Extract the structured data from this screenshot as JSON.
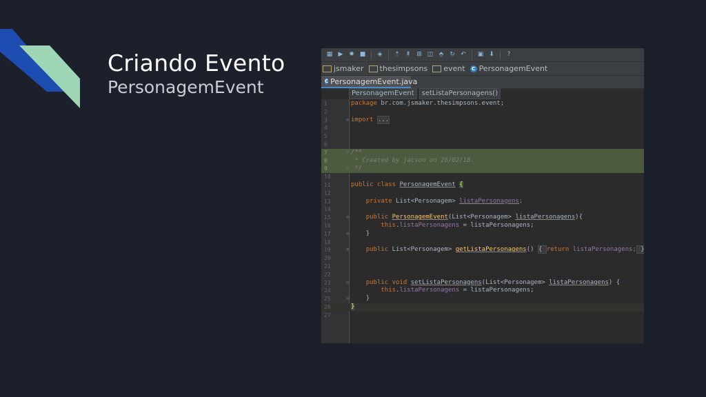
{
  "slide": {
    "title": "Criando Evento",
    "subtitle": "PersonagemEvent",
    "accent_blue": "#1d4db0",
    "accent_mint": "#9fd6b5"
  },
  "ide": {
    "toolbar_icons": [
      "build-icon",
      "run-icon",
      "debug-icon",
      "stop-icon",
      "attach-icon",
      "coverage-icon",
      "profile-icon",
      "sdk-icon",
      "avd-icon",
      "gradle-icon",
      "sync-icon",
      "undo-icon",
      "project-structure-icon",
      "sdk-manager-icon",
      "help-icon"
    ],
    "toolbar_glyphs": [
      "▦",
      "▶",
      "✹",
      "■",
      "◈",
      "⇡",
      "⇞",
      "⊞",
      "◫",
      "⬘",
      "↻",
      "↶",
      "▣",
      "⬇",
      "?"
    ],
    "breadcrumbs": [
      {
        "label": "jsmaker",
        "icon": "folder-icon"
      },
      {
        "label": "thesimpsons",
        "icon": "folder-icon"
      },
      {
        "label": "event",
        "icon": "folder-icon"
      },
      {
        "label": "PersonagemEvent",
        "icon": "class-icon"
      }
    ],
    "tab": {
      "label": "PersonagemEvent.java",
      "icon_letter": "C"
    },
    "code_breadcrumbs": [
      "PersonagemEvent",
      "setListaPersonagens()"
    ],
    "line_numbers": [
      "1",
      "2",
      "3",
      "4",
      "5",
      "6",
      "7",
      "8",
      "9",
      "10",
      "11",
      "12",
      "13",
      "14",
      "15",
      "16",
      "17",
      "18",
      "19",
      "20",
      "21",
      "22",
      "23",
      "24",
      "25",
      "26",
      "27"
    ]
  },
  "code": {
    "l1": [
      "package",
      " br.com.jsmaker.thesimpsons.event;"
    ],
    "l3": [
      "import",
      " ",
      "..."
    ],
    "l7": "/**",
    "l8": " * Created by jacson on 26/02/18.",
    "l9": " */",
    "l11": [
      "public class ",
      "PersonagemEvent",
      " ",
      "{"
    ],
    "l13": [
      "private ",
      "List<Personagem> ",
      "listaPersonagens",
      ";"
    ],
    "l15": [
      "public ",
      "PersonagemEvent",
      "(List<Personagem> ",
      "listaPersonagens",
      "){"
    ],
    "l16": [
      "this",
      ".",
      "listaPersonagens",
      " = listaPersonagens;"
    ],
    "l17": "}",
    "l19": [
      "public ",
      "List<Personagem> ",
      "getListaPersonagens",
      "() ",
      "{ ",
      "return ",
      "listaPersonagens",
      ";",
      " }"
    ],
    "l23": [
      "public void ",
      "setListaPersonagens",
      "(List<Personagem> ",
      "listaPersonagens",
      ") {"
    ],
    "l24": [
      "this",
      ".",
      "listaPersonagens",
      " = listaPersonagens;"
    ],
    "l25": "}",
    "l26": "}"
  }
}
